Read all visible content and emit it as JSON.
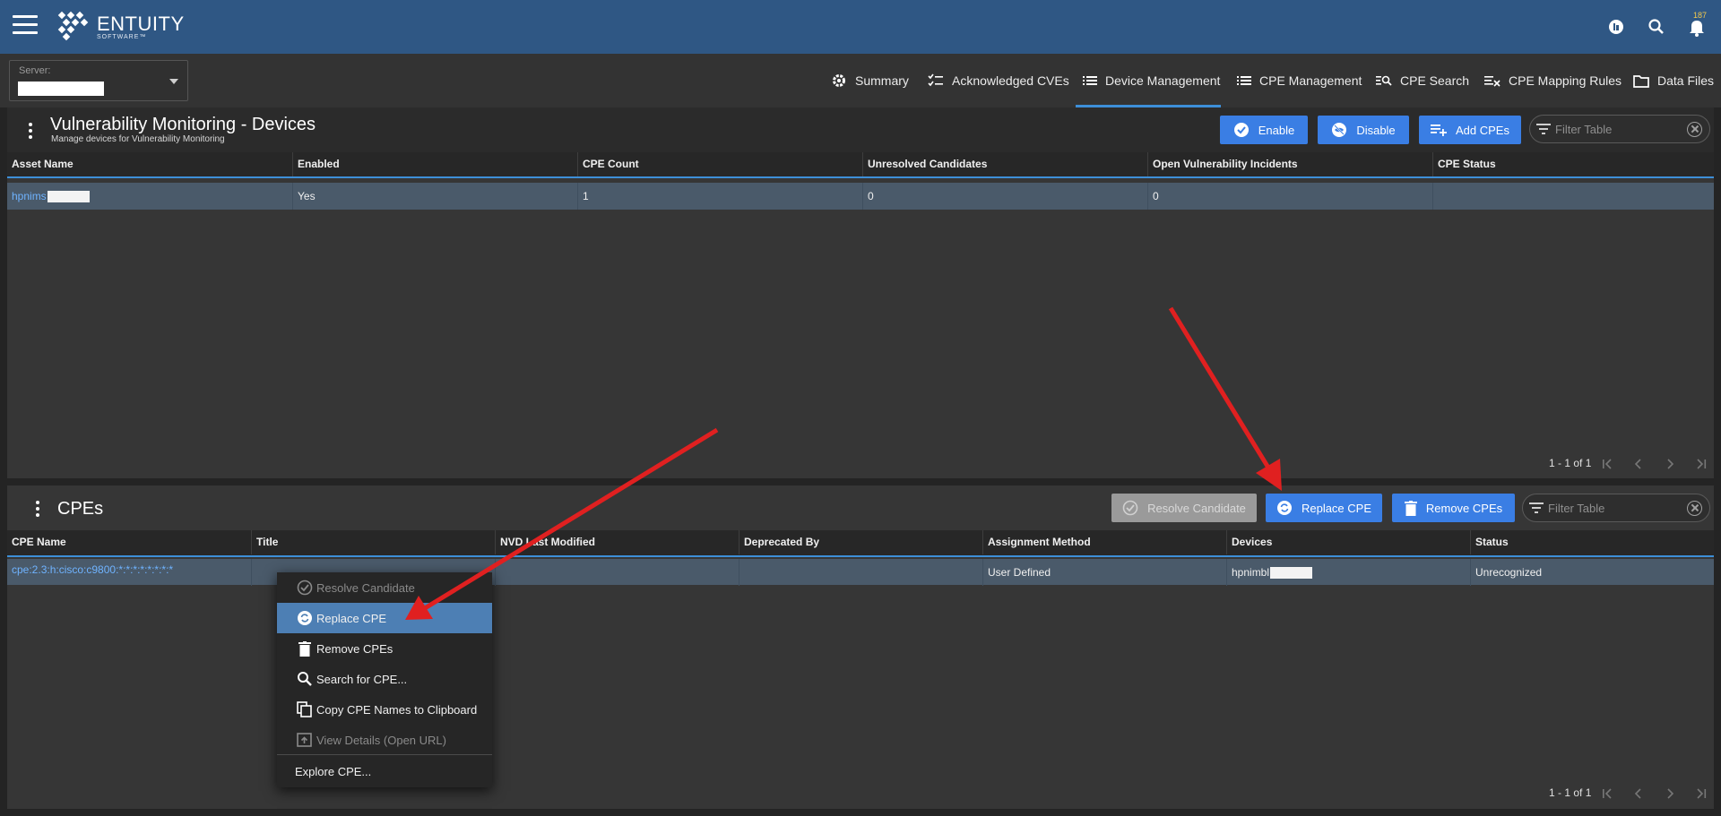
{
  "header": {
    "logo_name": "ENTUITY",
    "logo_sub": "SOFTWARE™",
    "notification_count": "187",
    "brand_color": "#2f5784"
  },
  "server": {
    "label": "Server:"
  },
  "tabs": [
    {
      "label": "Summary",
      "icon": "gear-icon"
    },
    {
      "label": "Acknowledged CVEs",
      "icon": "checklist-icon"
    },
    {
      "label": "Device Management",
      "icon": "list-icon",
      "active": true
    },
    {
      "label": "CPE Management",
      "icon": "list-icon"
    },
    {
      "label": "CPE Search",
      "icon": "search-list-icon"
    },
    {
      "label": "CPE Mapping Rules",
      "icon": "mapping-icon"
    },
    {
      "label": "Data Files",
      "icon": "folder-icon"
    }
  ],
  "devices_panel": {
    "title": "Vulnerability Monitoring - Devices",
    "subtitle": "Manage devices for Vulnerability Monitoring",
    "buttons": {
      "enable": "Enable",
      "disable": "Disable",
      "add_cpes": "Add CPEs"
    },
    "filter_placeholder": "Filter Table",
    "columns": [
      "Asset Name",
      "Enabled",
      "CPE Count",
      "Unresolved Candidates",
      "Open Vulnerability Incidents",
      "CPE Status"
    ],
    "rows": [
      {
        "asset_name": "hpnims",
        "enabled": "Yes",
        "cpe_count": "1",
        "unresolved": "0",
        "open_incidents": "0",
        "cpe_status": ""
      }
    ],
    "pager": "1 - 1 of 1"
  },
  "cpes_panel": {
    "title": "CPEs",
    "buttons": {
      "resolve": "Resolve Candidate",
      "replace": "Replace CPE",
      "remove": "Remove CPEs"
    },
    "filter_placeholder": "Filter Table",
    "columns": [
      "CPE Name",
      "Title",
      "NVD Last Modified",
      "Deprecated By",
      "Assignment Method",
      "Devices",
      "Status"
    ],
    "rows": [
      {
        "cpe_name": "cpe:2.3:h:cisco:c9800:*:*:*:*:*:*:*:*",
        "title": "",
        "nvd_last_modified": "",
        "deprecated_by": "",
        "assignment": "User Defined",
        "devices": "hpnimbl",
        "status": "Unrecognized"
      }
    ],
    "pager": "1 - 1 of 1"
  },
  "context_menu": [
    {
      "label": "Resolve Candidate",
      "disabled": true
    },
    {
      "label": "Replace CPE",
      "highlighted": true
    },
    {
      "label": "Remove CPEs"
    },
    {
      "label": "Search for CPE..."
    },
    {
      "label": "Copy CPE Names to Clipboard"
    },
    {
      "label": "View Details (Open URL)",
      "disabled": true
    },
    {
      "label": "Explore CPE..."
    }
  ],
  "colors": {
    "accent": "#3d8fd8",
    "button": "#3a7ee4",
    "annotation_arrow": "#e02020"
  }
}
